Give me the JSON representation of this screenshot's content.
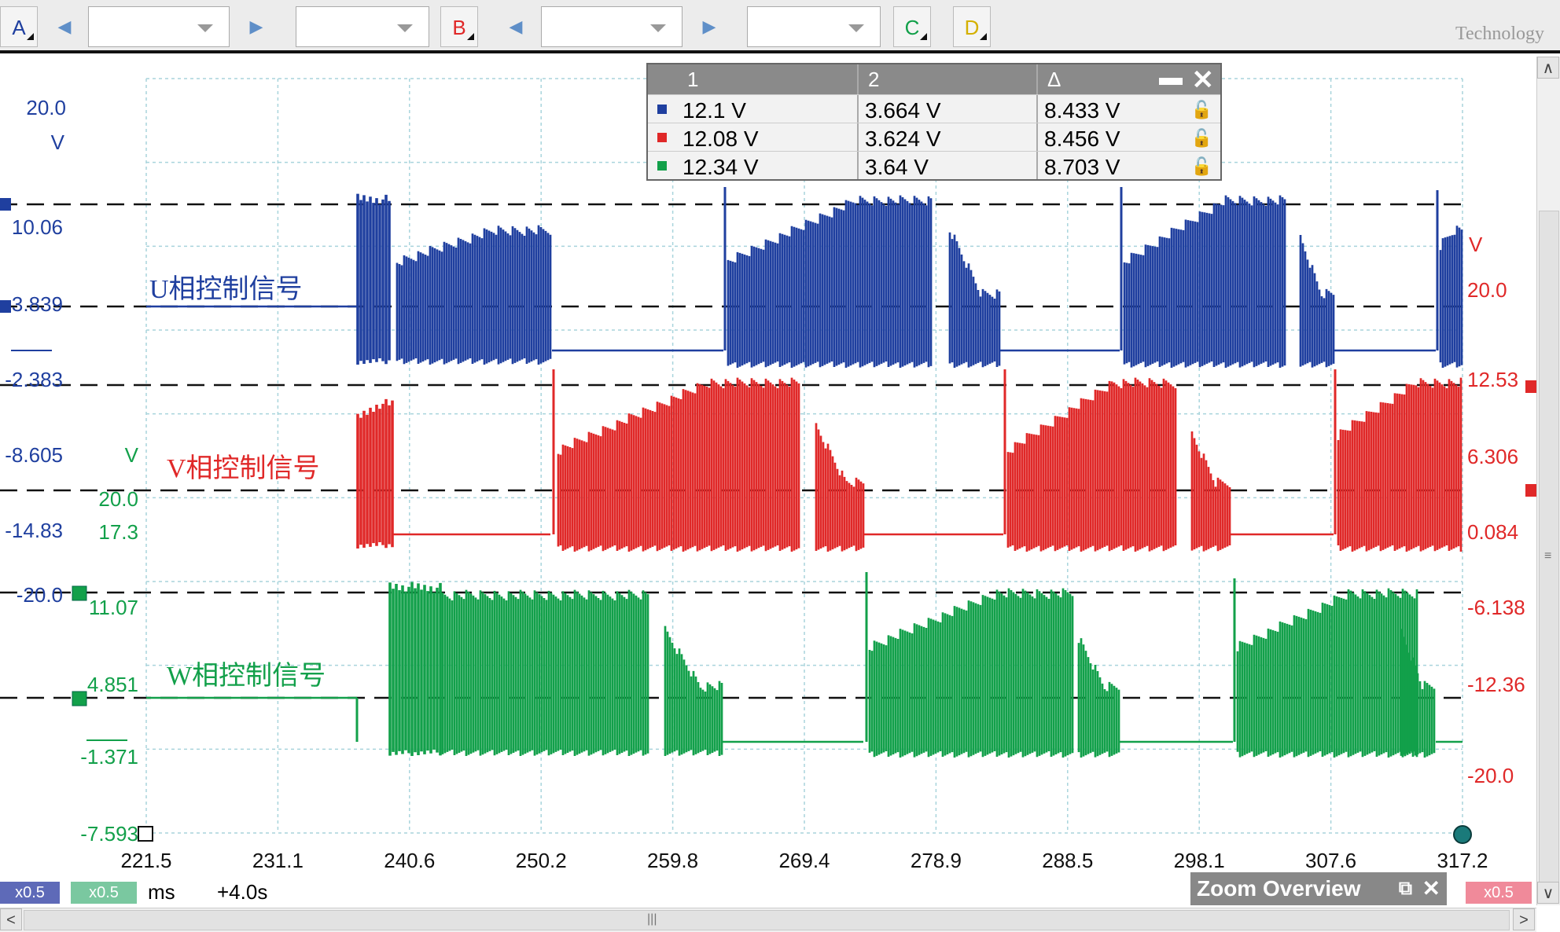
{
  "toolbar": {
    "channel_a": "A",
    "channel_b": "B",
    "channel_c": "C",
    "channel_d": "D",
    "logo_text": "Technology"
  },
  "measurements": {
    "headers": [
      "1",
      "2",
      "Δ"
    ],
    "rows": [
      {
        "channel_color": "#1f3f9f",
        "v1": "12.1 V",
        "v2": "3.664 V",
        "delta": "8.433 V"
      },
      {
        "channel_color": "#e02828",
        "v1": "12.08 V",
        "v2": "3.624 V",
        "delta": "8.456 V"
      },
      {
        "channel_color": "#12a04a",
        "v1": "12.34 V",
        "v2": "3.64 V",
        "delta": "8.703 V"
      }
    ]
  },
  "axes": {
    "blue_unit_top": "20.0",
    "blue_unit": "V",
    "blue_ticks": [
      "10.06",
      "3.839",
      "-2.383",
      "-8.605",
      "-14.83",
      "-20.0"
    ],
    "green_unit": "V",
    "green_ticks": [
      "20.0",
      "17.3",
      "11.07",
      "4.851",
      "-1.371",
      "-7.593"
    ],
    "red_unit": "V",
    "red_ticks": [
      "20.0",
      "12.53",
      "6.306",
      "0.084",
      "-6.138",
      "-12.36",
      "-20.0"
    ],
    "x_ticks": [
      "221.5",
      "231.1",
      "240.6",
      "250.2",
      "259.8",
      "269.4",
      "278.9",
      "288.5",
      "298.1",
      "307.6",
      "317.2"
    ]
  },
  "labels": {
    "u": "U相控制信号",
    "v": "V相控制信号",
    "w": "W相控制信号"
  },
  "bottombar": {
    "badge_a": "x0.5",
    "badge_b": "x0.5",
    "unit": "ms",
    "offset": "+4.0s",
    "badge_right": "x0.5",
    "zoom_overview": "Zoom Overview"
  },
  "colors": {
    "blue": "#1f3f9f",
    "red": "#e02828",
    "green": "#12a04a"
  }
}
